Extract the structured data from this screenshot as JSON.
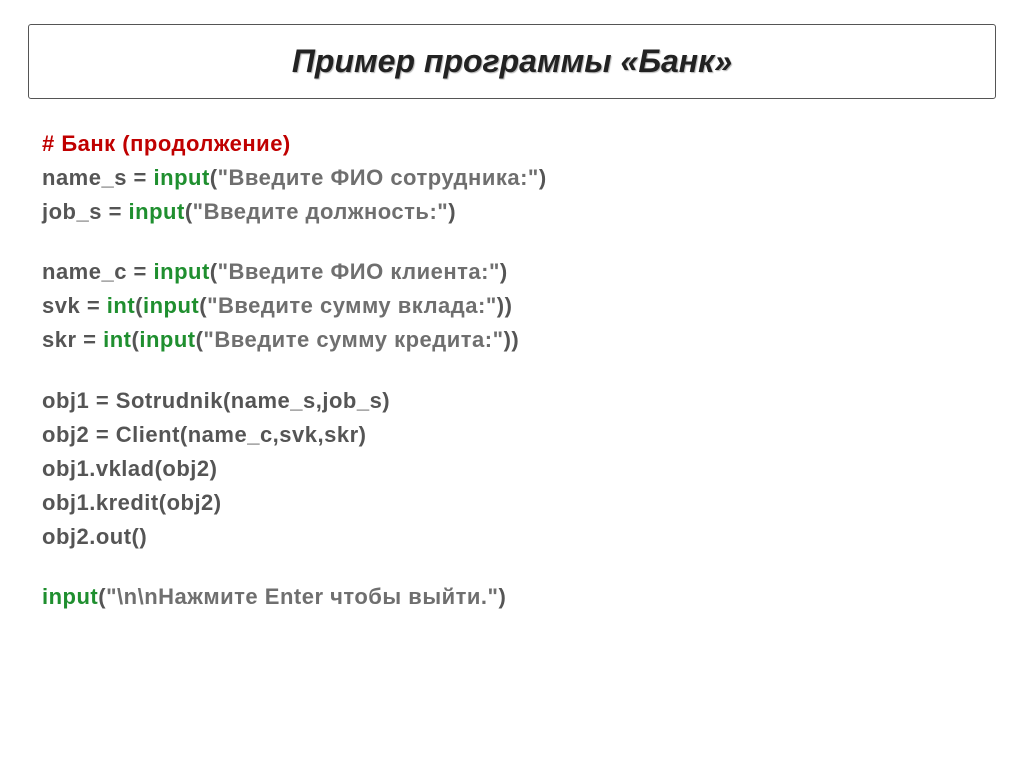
{
  "title": "Пример программы «Банк»",
  "comment": "# Банк (продолжение)",
  "lines": {
    "l1_a": "name_s = ",
    "l1_fn": "input",
    "l1_b": "(",
    "l1_str": "\"Введите ФИО сотрудника:\"",
    "l1_c": ")",
    "l2_a": "job_s  = ",
    "l2_fn": "input",
    "l2_b": "(",
    "l2_str": "\"Введите должность:\"",
    "l2_c": ")",
    "l3_a": "name_c = ",
    "l3_fn": "input",
    "l3_b": "(",
    "l3_str": "\"Введите ФИО клиента:\"",
    "l3_c": ")",
    "l4_a": "svk = ",
    "l4_fn1": "int",
    "l4_b": "(",
    "l4_fn2": "input",
    "l4_c": "(",
    "l4_str": "\"Введите сумму вклада:\"",
    "l4_d": "))",
    "l5_a": "skr = ",
    "l5_fn1": "int",
    "l5_b": "(",
    "l5_fn2": "input",
    "l5_c": "(",
    "l5_str": "\"Введите сумму кредита:\"",
    "l5_d": "))",
    "l6": "obj1 = Sotrudnik(name_s,job_s)",
    "l7": "obj2 = Client(name_c,svk,skr)",
    "l8": "obj1.vklad(obj2)",
    "l9": "obj1.kredit(obj2)",
    "l10": "obj2.out()",
    "l11_fn": "input",
    "l11_a": "(",
    "l11_str": "\"\\n\\nНажмите Enter чтобы выйти.\"",
    "l11_b": ")"
  }
}
